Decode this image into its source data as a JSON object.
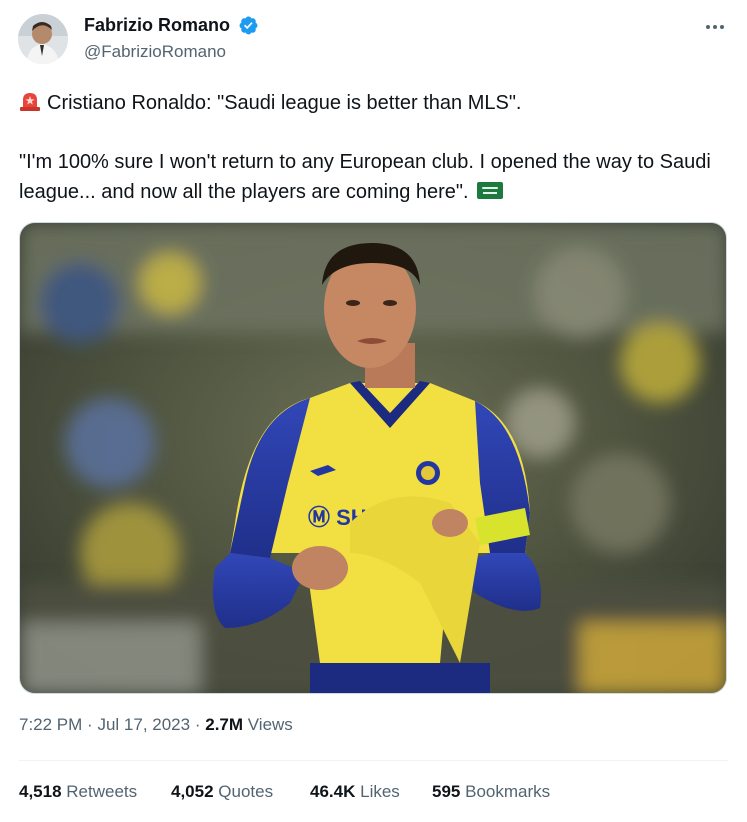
{
  "author": {
    "name": "Fabrizio Romano",
    "handle": "@FabrizioRomano"
  },
  "tweet": {
    "line1_text": "Cristiano Ronaldo: \"Saudi league is better than MLS\".",
    "line2_text": "\"I'm 100% sure I won't return to any European club. I opened the way to Saudi league... and now all the players are coming here\".",
    "emoji": [
      "police-siren",
      "saudi-flag"
    ]
  },
  "meta": {
    "time": "7:22 PM",
    "sep1": "·",
    "date": "Jul 17, 2023",
    "sep2": "·",
    "views_count": "2.7M",
    "views_label": "Views"
  },
  "stats": {
    "retweets_count": "4,518",
    "retweets_label": "Retweets",
    "quotes_count": "4,052",
    "quotes_label": "Quotes",
    "likes_count": "46.4K",
    "likes_label": "Likes",
    "bookmarks_count": "595",
    "bookmarks_label": "Bookmarks"
  },
  "colors": {
    "text_primary": "#0f1419",
    "text_secondary": "#536471",
    "verified_blue": "#1d9bf0",
    "jersey_yellow": "#f2e043",
    "jersey_blue": "#2a3ca6"
  }
}
